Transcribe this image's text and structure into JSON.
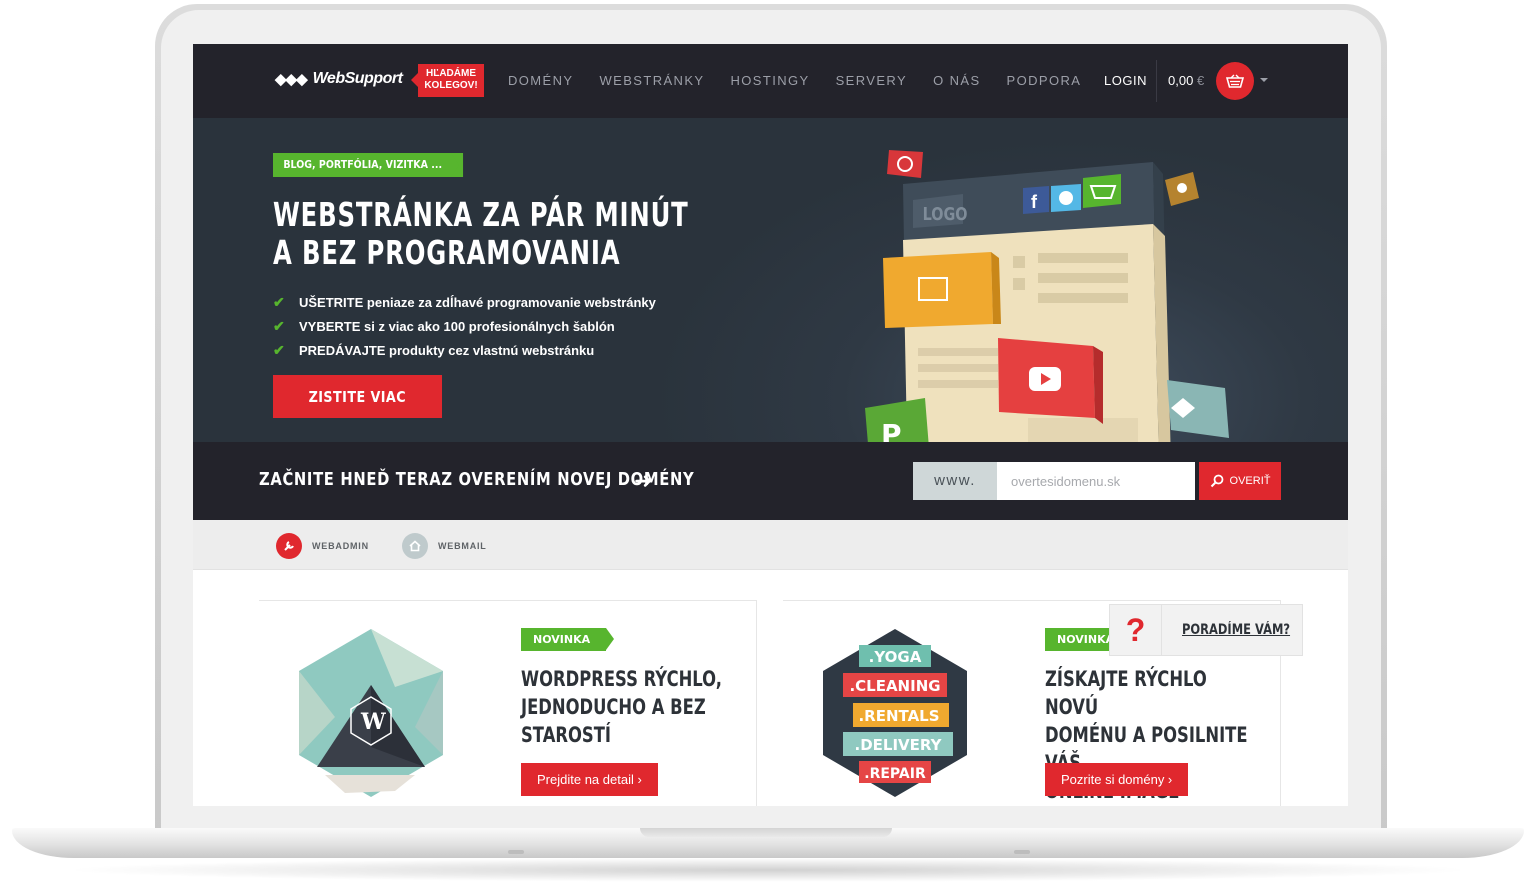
{
  "header": {
    "logo_text": "WebSupport",
    "logo_mark": "◆◆◆",
    "hiring_badge": [
      "HĽADÁME",
      "KOLEGOV!"
    ],
    "nav": [
      "DOMÉNY",
      "WEBSTRÁNKY",
      "HOSTINGY",
      "SERVERY",
      "O NÁS",
      "PODPORA"
    ],
    "login": "LOGIN",
    "cart_amount": "0,00",
    "cart_currency": "€"
  },
  "hero": {
    "tag": "BLOG, PORTFÓLIA, VIZITKA ...",
    "title_line1": "WEBSTRÁNKA ZA PÁR MINÚT",
    "title_line2": "A BEZ PROGRAMOVANIA",
    "bullets": [
      "UŠETRITE peniaze za zdĺhavé programovanie webstránky",
      "VYBERTE si z viac ako 100 profesionálnych šablón",
      "PREDÁVAJTE produkty cez vlastnú webstránku"
    ],
    "cta": "ZISTITE VIAC",
    "illustration_label": "LOGO"
  },
  "domain_search": {
    "cta_text": "ZAČNITE HNEĎ TERAZ OVERENÍM NOVEJ DOMÉNY",
    "prefix": "www.",
    "placeholder": "overtesidomenu.sk",
    "button": "OVERIŤ"
  },
  "quick_links": [
    {
      "label": "WEBADMIN",
      "icon": "wrench-icon",
      "color": "#e0282e"
    },
    {
      "label": "WEBMAIL",
      "icon": "home-icon",
      "color": "#bfcacc"
    }
  ],
  "cards": [
    {
      "badge": "NOVINKA",
      "title": [
        "WORDPRESS RÝCHLO,",
        "JEDNODUCHO A BEZ",
        "STAROSTÍ"
      ],
      "button": "Prejdite na detail ›"
    },
    {
      "badge": "NOVINKA",
      "title": [
        "ZÍSKAJTE RÝCHLO NOVÚ",
        "DOMÉNU A POSILNITE VÁŠ",
        "ONLINE IMAGE"
      ],
      "button": "Pozrite si domény ›",
      "tlds": [
        ".YOGA",
        ".CLEANING",
        ".RENTALS",
        ".DELIVERY",
        ".REPAIR"
      ]
    }
  ],
  "help": {
    "icon": "?",
    "text": "PORADÍME VÁM?"
  },
  "colors": {
    "accent_red": "#e0282e",
    "accent_green": "#57b52e",
    "header_dark": "#23232b",
    "hero_bg": "#2f3944"
  }
}
